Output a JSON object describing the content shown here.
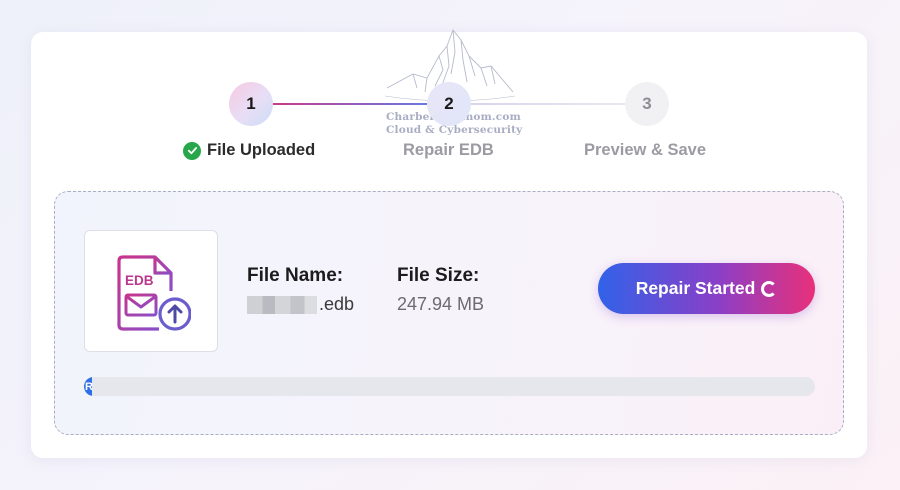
{
  "watermark": {
    "line1": "Charbel Nemnom.com",
    "line2": "Cloud & Cybersecurity"
  },
  "stepper": {
    "steps": [
      {
        "number": "1",
        "label": "File Uploaded",
        "state": "completed"
      },
      {
        "number": "2",
        "label": "Repair EDB",
        "state": "active"
      },
      {
        "number": "3",
        "label": "Preview & Save",
        "state": "pending"
      }
    ]
  },
  "file": {
    "icon_text": "EDB",
    "name_label": "File Name:",
    "name_value": ".edb",
    "size_label": "File Size:",
    "size_value": "247.94 MB"
  },
  "action": {
    "label": "Repair Started"
  },
  "progress": {
    "fraction": 0.01,
    "text": "R"
  },
  "colors": {
    "accent_blue": "#3162e9",
    "accent_pink": "#e8307a",
    "success": "#27a74a"
  }
}
